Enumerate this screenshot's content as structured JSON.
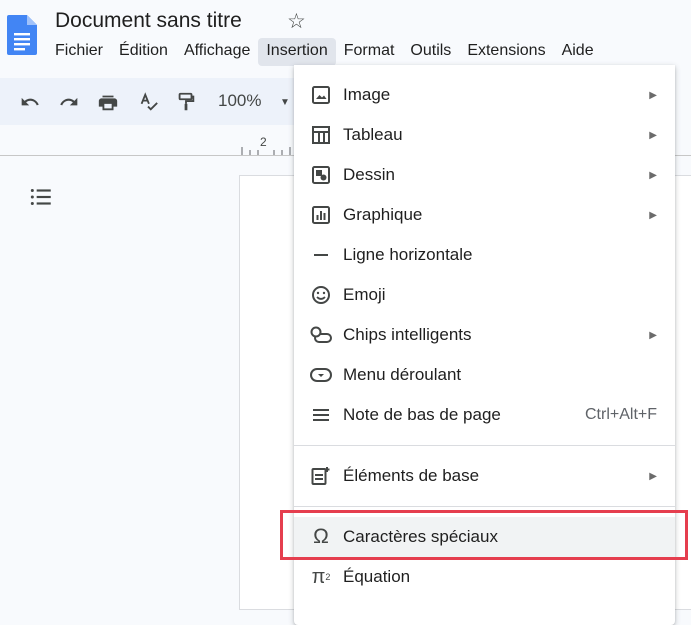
{
  "document": {
    "title": "Document sans titre"
  },
  "menubar": [
    "Fichier",
    "Édition",
    "Affichage",
    "Insertion",
    "Format",
    "Outils",
    "Extensions",
    "Aide"
  ],
  "toolbar": {
    "zoom": "100%"
  },
  "ruler": {
    "mark": "2"
  },
  "insert_menu": {
    "items": [
      {
        "label": "Image",
        "icon": "image-icon",
        "submenu": true
      },
      {
        "label": "Tableau",
        "icon": "table-icon",
        "submenu": true
      },
      {
        "label": "Dessin",
        "icon": "drawing-icon",
        "submenu": true
      },
      {
        "label": "Graphique",
        "icon": "chart-icon",
        "submenu": true
      },
      {
        "label": "Ligne horizontale",
        "icon": "horizontal-line-icon",
        "submenu": false
      },
      {
        "label": "Emoji",
        "icon": "emoji-icon",
        "submenu": false
      },
      {
        "label": "Chips intelligents",
        "icon": "smart-chips-icon",
        "submenu": true
      },
      {
        "label": "Menu déroulant",
        "icon": "dropdown-icon",
        "submenu": false
      },
      {
        "label": "Note de bas de page",
        "icon": "footnote-icon",
        "submenu": false,
        "shortcut": "Ctrl+Alt+F"
      },
      {
        "label": "Éléments de base",
        "icon": "building-blocks-icon",
        "submenu": true
      },
      {
        "label": "Caractères spéciaux",
        "icon": "omega-icon",
        "submenu": false,
        "highlighted": true
      },
      {
        "label": "Équation",
        "icon": "pi-icon",
        "submenu": false
      }
    ]
  },
  "colors": {
    "accent": "#1a73e8",
    "highlight_border": "#e53e4e",
    "menu_active": "#e1e5ec"
  }
}
